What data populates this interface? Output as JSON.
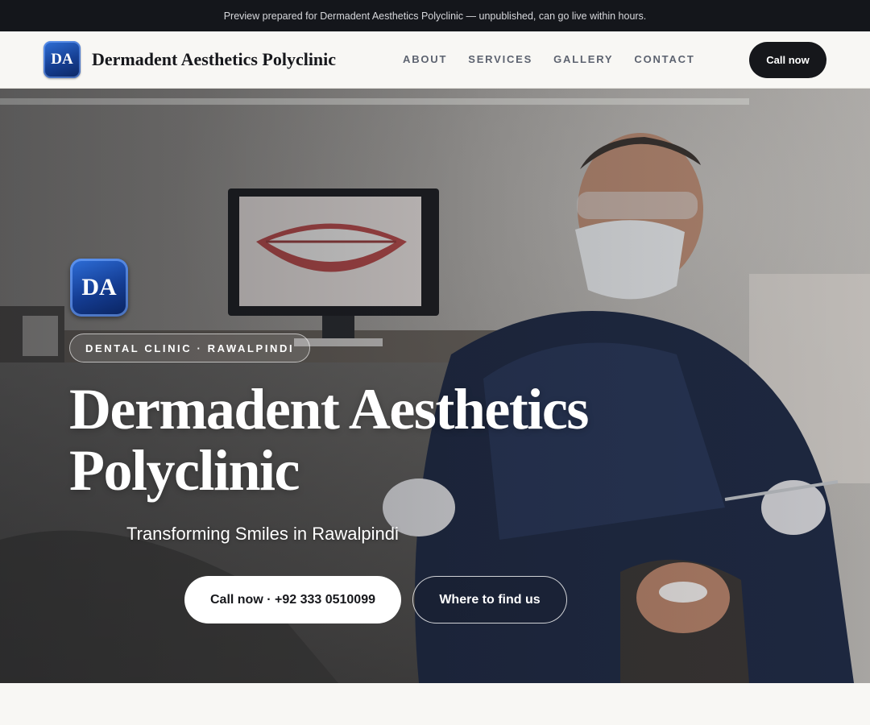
{
  "preview_bar": {
    "text": "Preview prepared for Dermadent Aesthetics Polyclinic — unpublished, can go live within hours."
  },
  "header": {
    "logo_initials": "DA",
    "brand_name": "Dermadent Aesthetics Polyclinic",
    "nav": [
      {
        "label": "ABOUT"
      },
      {
        "label": "SERVICES"
      },
      {
        "label": "GALLERY"
      },
      {
        "label": "CONTACT"
      }
    ],
    "call_button": "Call now"
  },
  "hero": {
    "logo_initials": "DA",
    "badge": "DENTAL CLINIC · RAWALPINDI",
    "title": "Dermadent Aesthetics Polyclinic",
    "subtitle": "Transforming Smiles in Rawalpindi",
    "cta_primary": "Call now · +92 333 0510099",
    "cta_secondary": "Where to find us",
    "background_image": "dentist-with-patient-photo"
  },
  "colors": {
    "dark": "#16171b",
    "page_bg": "#f8f7f4",
    "brand_blue": "#163f93",
    "nav_text": "#5d6370"
  }
}
